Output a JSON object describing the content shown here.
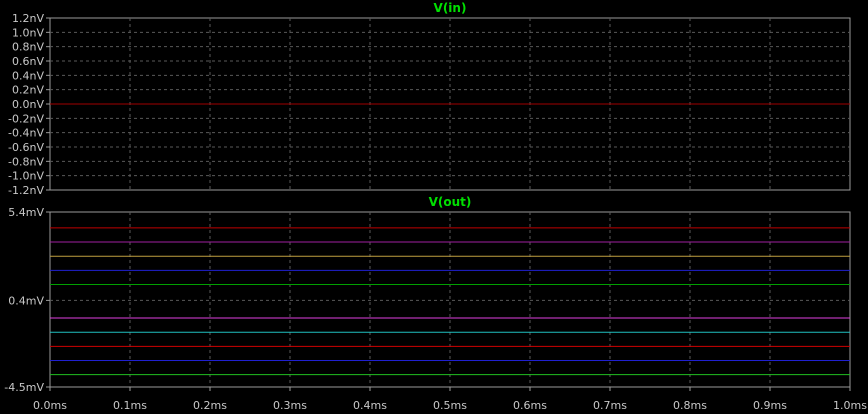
{
  "chart_data": [
    {
      "type": "line",
      "title": "V(in)",
      "x": [
        0.0,
        1.0
      ],
      "xlim": [
        0.0,
        1.0
      ],
      "ylim": [
        -1.2,
        1.2
      ],
      "y_ticks": [
        1.2,
        1.0,
        0.8,
        0.6,
        0.4,
        0.2,
        0.0,
        -0.2,
        -0.4,
        -0.6,
        -0.8,
        -1.0,
        -1.2
      ],
      "y_tick_labels": [
        "1.2nV",
        "1.0nV",
        "0.8nV",
        "0.6nV",
        "0.4nV",
        "0.2nV",
        "0.0nV",
        "-0.2nV",
        "-0.4nV",
        "-0.6nV",
        "-0.8nV",
        "-1.0nV",
        "-1.2nV"
      ],
      "grid": true,
      "series": [
        {
          "color": "#a00000",
          "values": [
            0.0,
            0.0
          ]
        }
      ]
    },
    {
      "type": "line",
      "title": "V(out)",
      "x": [
        0.0,
        1.0
      ],
      "xlim": [
        0.0,
        1.0
      ],
      "ylim": [
        -4.5,
        5.4
      ],
      "y_ticks": [
        5.4,
        0.4,
        -4.5
      ],
      "y_tick_labels": [
        "5.4mV",
        "0.4mV",
        "-4.5mV"
      ],
      "grid": true,
      "series": [
        {
          "color": "#c00000",
          "values": [
            4.5,
            4.5
          ]
        },
        {
          "color": "#a020a0",
          "values": [
            3.7,
            3.7
          ]
        },
        {
          "color": "#c0a040",
          "values": [
            2.9,
            2.9
          ]
        },
        {
          "color": "#2020d0",
          "values": [
            2.1,
            2.1
          ]
        },
        {
          "color": "#00a000",
          "values": [
            1.3,
            1.3
          ]
        },
        {
          "color": "#e040e0",
          "values": [
            -0.6,
            -0.6
          ]
        },
        {
          "color": "#20c0c0",
          "values": [
            -1.4,
            -1.4
          ]
        },
        {
          "color": "#d00000",
          "values": [
            -2.2,
            -2.2
          ]
        },
        {
          "color": "#2020d0",
          "values": [
            -3.0,
            -3.0
          ]
        },
        {
          "color": "#20c020",
          "values": [
            -3.8,
            -3.8
          ]
        }
      ]
    }
  ],
  "x_axis": {
    "ticks": [
      0.0,
      0.1,
      0.2,
      0.3,
      0.4,
      0.5,
      0.6,
      0.7,
      0.8,
      0.9,
      1.0
    ],
    "tick_labels": [
      "0.0ms",
      "0.1ms",
      "0.2ms",
      "0.3ms",
      "0.4ms",
      "0.5ms",
      "0.6ms",
      "0.7ms",
      "0.8ms",
      "0.9ms",
      "1.0ms"
    ]
  },
  "colors": {
    "background": "#000000",
    "frame": "#9a9a9a",
    "grid": "#5a5a5a",
    "title": "#00e000",
    "tick_text": "#c8c8c8"
  }
}
